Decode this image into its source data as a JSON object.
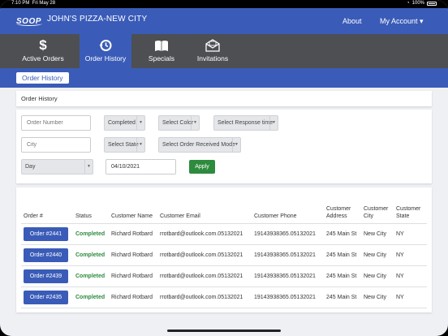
{
  "statusbar": {
    "time": "7:10 PM",
    "date": "Fri May 28",
    "battery": "100%"
  },
  "header": {
    "logo_text": "SOOP",
    "store_name": "JOHN'S PIZZA-NEW CITY",
    "about": "About",
    "account": "My Account ▾"
  },
  "tabs": [
    {
      "label": "Active Orders",
      "icon": "dollar-icon",
      "active": false
    },
    {
      "label": "Order History",
      "icon": "history-icon",
      "active": true
    },
    {
      "label": "Specials",
      "icon": "book-icon",
      "active": false
    },
    {
      "label": "Invitations",
      "icon": "envelope-icon",
      "active": false
    }
  ],
  "breadcrumb": {
    "label": "Order History"
  },
  "section_title": "Order History",
  "filters": {
    "order_number_placeholder": "Order Number",
    "status_value": "Completed",
    "color_value": "Select Color",
    "response_time_value": "Select Response time",
    "city_placeholder": "City",
    "state_value": "Select State",
    "received_mode_value": "Select Order Received Mode",
    "period_value": "Day",
    "date_value": "04/10/2021",
    "apply_label": "Apply"
  },
  "table": {
    "headers": [
      "Order #",
      "Status",
      "Customer Name",
      "Customer Email",
      "Customer Phone",
      "Customer Address",
      "Customer City",
      "Customer State"
    ],
    "rows": [
      {
        "order": "Order #2441",
        "status": "Completed",
        "name": "Richard Rotbard",
        "email": "rrotbard@outlook.com.05132021",
        "phone": "19143938365.05132021",
        "address": "245 Main St",
        "city": "New City",
        "state": "NY"
      },
      {
        "order": "Order #2440",
        "status": "Completed",
        "name": "Richard Rotbard",
        "email": "rrotbard@outlook.com.05132021",
        "phone": "19143938365.05132021",
        "address": "245 Main St",
        "city": "New City",
        "state": "NY"
      },
      {
        "order": "Order #2439",
        "status": "Completed",
        "name": "Richard Rotbard",
        "email": "rrotbard@outlook.com.05132021",
        "phone": "19143938365.05132021",
        "address": "245 Main St",
        "city": "New City",
        "state": "NY"
      },
      {
        "order": "Order #2435",
        "status": "Completed",
        "name": "Richard Rotbard",
        "email": "rrotbard@outlook.com.05132021",
        "phone": "19143938365.05132021",
        "address": "245 Main St",
        "city": "New City",
        "state": "NY"
      }
    ]
  },
  "colors": {
    "primary": "#3a5cb8",
    "tabbar": "#4d4f52",
    "success": "#2e8b3e"
  }
}
